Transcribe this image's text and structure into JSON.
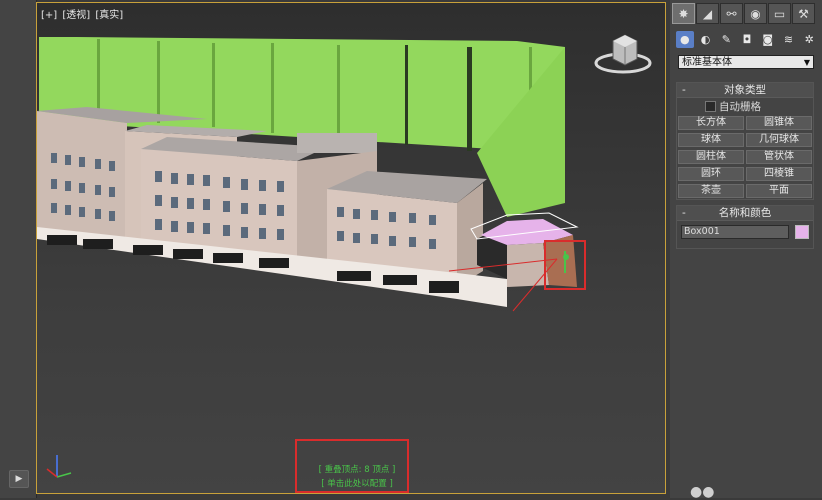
{
  "viewport": {
    "labels": [
      "[+]",
      "[透视]",
      "[真实]"
    ]
  },
  "status_prompt": {
    "line1": "[ 重叠顶点: 8 顶点 ]",
    "line2": "[ 单击此处以配置 ]"
  },
  "command_panel": {
    "tabs": [
      {
        "icon": "create-icon"
      },
      {
        "icon": "modify-icon"
      },
      {
        "icon": "hierarchy-icon"
      },
      {
        "icon": "motion-icon"
      },
      {
        "icon": "display-icon"
      },
      {
        "icon": "utilities-icon"
      }
    ],
    "subtabs": [
      {
        "icon": "geometry-icon"
      },
      {
        "icon": "shapes-icon"
      },
      {
        "icon": "lights-icon"
      },
      {
        "icon": "cameras-icon"
      },
      {
        "icon": "helpers-icon"
      },
      {
        "icon": "space-warps-icon"
      },
      {
        "icon": "systems-icon"
      }
    ],
    "category_dropdown": "标准基本体",
    "object_type": {
      "title": "对象类型",
      "autogrid_label": "自动栅格",
      "buttons": [
        "长方体",
        "圆锥体",
        "球体",
        "几何球体",
        "圆柱体",
        "管状体",
        "圆环",
        "四棱锥",
        "茶壶",
        "平面"
      ]
    },
    "name_and_color": {
      "title": "名称和颜色",
      "object_name": "Box001",
      "object_color": "#e6b3ea"
    }
  },
  "colors": {
    "viewport_border": "#c8a13a",
    "highlight_red": "#d92c2c",
    "prompt_green": "#49c44a",
    "active_subtab": "#5a7fc7"
  }
}
